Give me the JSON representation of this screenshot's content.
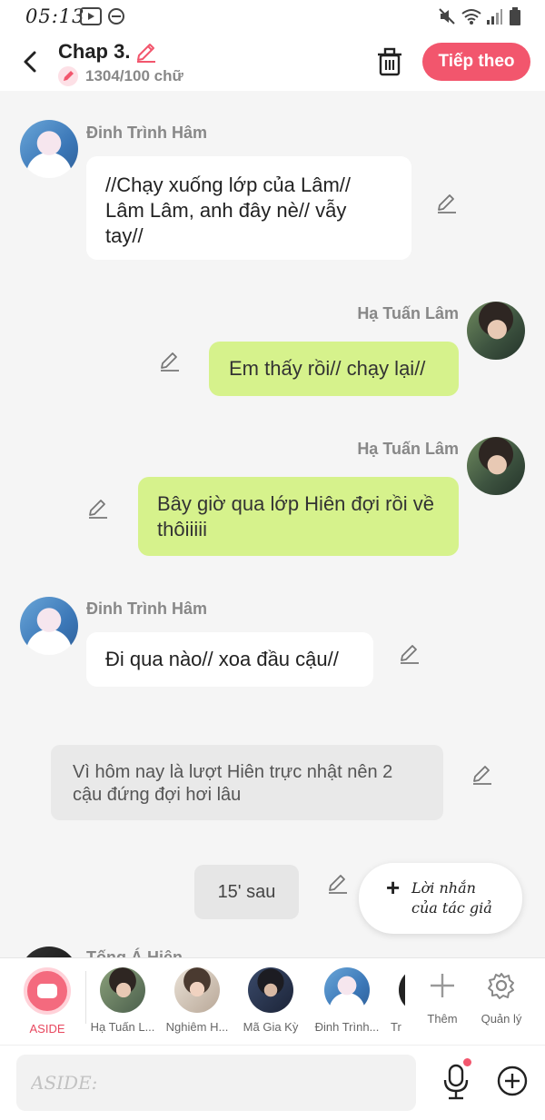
{
  "status_bar": {
    "time": "05:13"
  },
  "header": {
    "title": "Chap 3.",
    "word_count": "1304/100 chữ",
    "next_label": "Tiếp theo",
    "accent": "#f2566d"
  },
  "messages": [
    {
      "speaker": "Đinh Trình Hâm",
      "side": "left",
      "lines": [
        "//Chạy xuống lớp của Lâm//",
        "Lâm Lâm, anh đây nè// vẫy",
        "tay//"
      ]
    },
    {
      "speaker": "Hạ Tuấn Lâm",
      "side": "right",
      "lines": [
        "Em thấy rồi// chạy lại//"
      ]
    },
    {
      "speaker": "Hạ Tuấn Lâm",
      "side": "right",
      "lines": [
        "Bây giờ qua lớp Hiên đợi rồi về",
        "thôiiiii"
      ]
    },
    {
      "speaker": "Đinh Trình Hâm",
      "side": "left",
      "lines": [
        "Đi qua nào// xoa đầu cậu//"
      ]
    }
  ],
  "narration": {
    "lines": [
      "Vì hôm nay là lượt Hiên trực nhật nên 2",
      "cậu đứng đợi hơi lâu"
    ]
  },
  "time_chip": "15' sau",
  "author_note": {
    "line1": "Lời nhắn",
    "line2": "của tác giả"
  },
  "partial_speaker": "Tống Á Hiên",
  "character_bar": {
    "aside_label": "ASIDE",
    "characters": [
      "Hạ Tuấn L...",
      "Nghiêm H...",
      "Mã Gia Kỳ",
      "Đinh Trình...",
      "Tr"
    ],
    "add_label": "Thêm",
    "manage_label": "Quản lý"
  },
  "input": {
    "placeholder": "ASIDE:"
  },
  "colors": {
    "right_bubble": "#d6f28c",
    "left_bubble": "#ffffff",
    "accent": "#f2566d",
    "aside_tab": "#f46a7e"
  }
}
